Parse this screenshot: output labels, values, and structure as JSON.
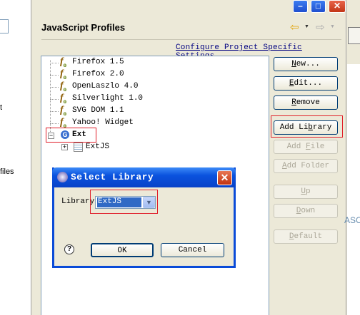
{
  "left_pane": {
    "fragments": [
      "t",
      "files"
    ]
  },
  "window_controls": {
    "maximize": "□",
    "close": "✕"
  },
  "header": {
    "title": "JavaScript Profiles",
    "back_glyph": "⇦",
    "forward_glyph": "⇨",
    "dropdown_glyph": "▼"
  },
  "config_link": "Configure Project Specific Settings...",
  "tree": {
    "profiles": [
      "Firefox 1.5",
      "Firefox 2.0",
      "OpenLaszlo 4.0",
      "Silverlight 1.0",
      "SVG DOM 1.1",
      "Yahoo! Widget"
    ],
    "profile_icon": "fo-icon",
    "library": "Ext",
    "library_child": "ExtJS",
    "collapse_glyph": "−",
    "expand_glyph": "+",
    "library_icon_glyph": "G"
  },
  "buttons": {
    "new": {
      "before": "",
      "mnemonic": "N",
      "after": "ew..."
    },
    "edit": {
      "before": "",
      "mnemonic": "E",
      "after": "dit..."
    },
    "remove": {
      "before": "",
      "mnemonic": "R",
      "after": "emove"
    },
    "add_library": {
      "before": "Add Li",
      "mnemonic": "b",
      "after": "rary"
    },
    "add_file": {
      "before": "Add ",
      "mnemonic": "F",
      "after": "ile"
    },
    "add_folder": {
      "before": "",
      "mnemonic": "A",
      "after": "dd Folder"
    },
    "up": {
      "before": "",
      "mnemonic": "U",
      "after": "p"
    },
    "down": {
      "before": "",
      "mnemonic": "D",
      "after": "own"
    },
    "default": {
      "before": "",
      "mnemonic": "D",
      "after": "efault"
    }
  },
  "dialog": {
    "title": "Select Library",
    "close_glyph": "✕",
    "library_label": "Library",
    "library_value": "ExtJS",
    "select_arrow": "▼",
    "help_glyph": "?",
    "ok": "OK",
    "cancel": "Cancel"
  },
  "right_edge": {
    "text": "ASC"
  },
  "colors": {
    "highlight": "#e01f2a",
    "title_bar": "#0a52de",
    "link": "#000080"
  }
}
